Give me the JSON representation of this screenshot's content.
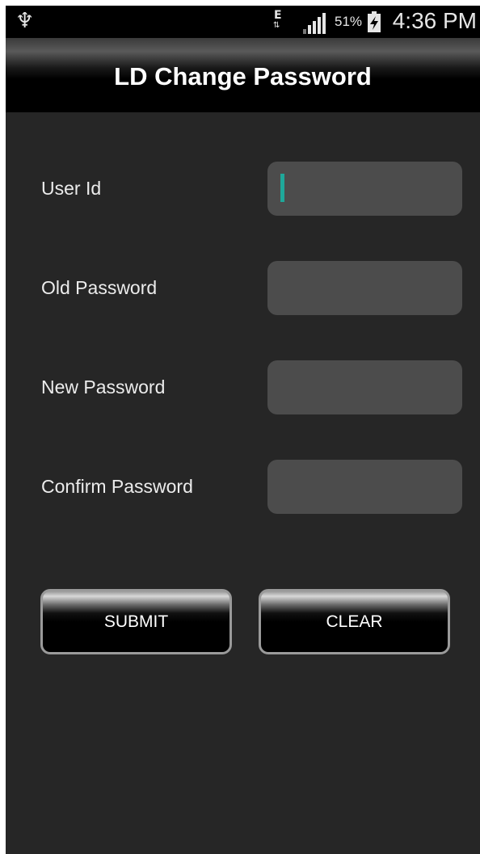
{
  "status_bar": {
    "network_type": "E",
    "network_arrows": "⇅",
    "battery_percent": "51%",
    "time": "4:36 PM",
    "icons": [
      "usb-icon",
      "network-activity-icon",
      "signal-strength-icon",
      "battery-charging-icon"
    ]
  },
  "header": {
    "title": "LD Change Password"
  },
  "form": {
    "fields": [
      {
        "label": "User Id",
        "value": "",
        "placeholder": "",
        "focused": true
      },
      {
        "label": "Old Password",
        "value": "",
        "placeholder": ""
      },
      {
        "label": "New Password",
        "value": "",
        "placeholder": ""
      },
      {
        "label": "Confirm Password",
        "value": "",
        "placeholder": ""
      }
    ]
  },
  "buttons": {
    "submit_label": "SUBMIT",
    "clear_label": "CLEAR"
  },
  "colors": {
    "background": "#262626",
    "input_background": "#4c4c4c",
    "cursor": "#1fa89a",
    "text": "#ececec"
  }
}
